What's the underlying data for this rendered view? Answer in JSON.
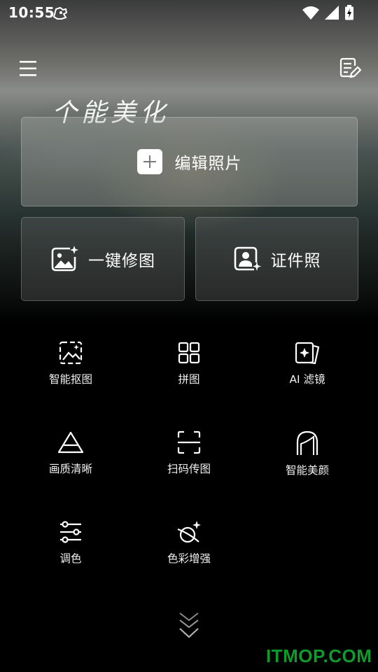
{
  "status_bar": {
    "time": "10:55",
    "icons": [
      "app-notification-icon",
      "wifi-icon",
      "signal-icon",
      "battery-charging-icon"
    ]
  },
  "header": {
    "menu_icon": "hamburger-menu-icon",
    "notes_icon": "notes-edit-icon",
    "script_text": "个能美化"
  },
  "primary_actions": {
    "edit_photo": "编辑照片",
    "one_click_retouch": "一键修图",
    "id_photo": "证件照"
  },
  "tools": [
    {
      "label": "智能抠图",
      "icon": "smart-cutout-icon"
    },
    {
      "label": "拼图",
      "icon": "collage-grid-icon"
    },
    {
      "label": "AI 滤镜",
      "icon": "ai-filter-icon"
    },
    {
      "label": "画质清晰",
      "icon": "clarity-triangle-icon"
    },
    {
      "label": "扫码传图",
      "icon": "scan-frame-icon"
    },
    {
      "label": "智能美颜",
      "icon": "beauty-face-icon"
    },
    {
      "label": "调色",
      "icon": "color-adjust-sliders-icon"
    },
    {
      "label": "色彩增强",
      "icon": "color-enhance-icon"
    }
  ],
  "footer": {
    "more_icon": "double-chevron-down-icon",
    "watermark": "ITMOP.COM"
  },
  "colors": {
    "background": "#000000",
    "watermark": "#0e9a2c"
  }
}
